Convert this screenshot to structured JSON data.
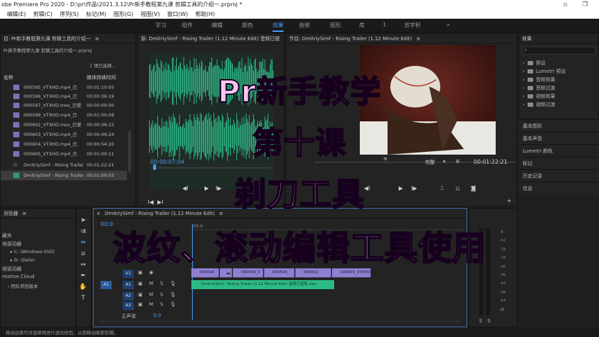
{
  "window": {
    "title": "obe Premiere Pro 2020 - D:\\pr\\作品\\2021.3.12\\Pr新手教程第九课 剪辑工具的介绍一.prproj *"
  },
  "menu": [
    "编辑(E)",
    "剪辑(C)",
    "序列(S)",
    "标记(M)",
    "图形(G)",
    "视图(V)",
    "窗口(W)",
    "帮助(H)"
  ],
  "workspaces": [
    "学习",
    "组件",
    "编辑",
    "颜色",
    "效果",
    "音频",
    "图形",
    "库",
    "1",
    "苏宇轩"
  ],
  "workspaces_more": "»",
  "active_workspace": "效果",
  "project": {
    "title": "目: Pr新手教程第九课 剪辑工具的介绍一",
    "path": "Pr新手教程第九课 剪辑工具的介绍一.prproj",
    "selection_info": "1 项已选择...",
    "col_name": "名称",
    "col_duration": "媒体持续时间",
    "rows": [
      {
        "name": "000595_VTXHD.mp4_已",
        "duration": "00:01:10:05",
        "kind": "video"
      },
      {
        "name": "000596_VTXHD.mp4_已",
        "duration": "00:00:36:19",
        "kind": "video"
      },
      {
        "name": "000597_VTXHD.mov_已使",
        "duration": "00:00:09:00",
        "kind": "video"
      },
      {
        "name": "000599_VTXHD.mp4_已",
        "duration": "00:01:00:09",
        "kind": "video"
      },
      {
        "name": "000602_VTXHD.mov_已使",
        "duration": "00:00:36:15",
        "kind": "video"
      },
      {
        "name": "000603_VTXHD.mp4_已",
        "duration": "00:00:46:24",
        "kind": "video"
      },
      {
        "name": "000604_VTXHD.mp4_已",
        "duration": "00:00:54:20",
        "kind": "video"
      },
      {
        "name": "000605_VTXHD.mp4_已",
        "duration": "00:01:00:11",
        "kind": "video"
      },
      {
        "name": "DmitriySimf - Rising Trailer",
        "duration": "00:01:22:21",
        "kind": "audio"
      },
      {
        "name": "DmitriySimf - Rising Trailer",
        "duration": "00:01:09:03",
        "kind": "sequence"
      }
    ]
  },
  "source": {
    "title": "源: DmitriySimf - Rising Trailer (1.12 Minute Edit) 音频已提",
    "timecode": "00:00:07:04"
  },
  "program": {
    "title": "节目: DmitriySimf - Rising Trailer (1.12 Minute Edit)",
    "quality": "完整",
    "timecode": "00:01:22:21"
  },
  "effects": {
    "title": "效果",
    "items": [
      "预设",
      "Lumetri 预设",
      "音频效果",
      "音频过渡",
      "视频效果",
      "视频过渡"
    ],
    "side_panels": [
      "基本图形",
      "基本声音",
      "Lumetri 颜色",
      "标记",
      "历史记录",
      "信息"
    ]
  },
  "media_browser": {
    "title": "浏览器",
    "items": [
      "藏夹",
      "地驱动器",
      "C: (Windows-SSD)",
      "D: (Data)",
      "络驱动器",
      "reative Cloud",
      "团队项目版本"
    ]
  },
  "timeline": {
    "title": "DmitriySimf - Rising Trailer (1.12 Minute Edit)",
    "timecode": "00:0",
    "ruler_mark": ";00:0",
    "tracks_v": [
      "V1"
    ],
    "tracks_a": [
      "A1",
      "A2",
      "A3"
    ],
    "src_patch": "A1",
    "master": "主声道",
    "master_val": "0.0",
    "video_clips": [
      "000594",
      "",
      "000596_V",
      "000599_",
      "000602",
      "000605_VTXHD."
    ],
    "audio_clip": "DmitriySimf - Rising Trailer (1.12 Minute Edit) 音频已提取.wav",
    "meter_labels": [
      "S",
      "S"
    ],
    "meter_db": [
      "-6",
      "-12",
      "-18",
      "-24",
      "-30",
      "-36",
      "-42",
      "-48",
      "-54",
      "dB"
    ]
  },
  "overlay": {
    "line1": "Pr新手教学",
    "line2": "第十课",
    "line3": "剃刀工具",
    "line4": "波纹、滚动编辑工具使用"
  },
  "status": "拖动边缘可对选择项进行波纹修剪。从而移动尾部剪辑。",
  "icons": {
    "close": "close-icon",
    "maximize": "maximize-icon",
    "menu": "hamburger-icon",
    "folder": "folder-icon",
    "play": "play-icon",
    "step_back": "step-back-icon",
    "step_fwd": "step-forward-icon",
    "wrench": "wrench-icon",
    "search": "search-icon"
  },
  "colors": {
    "accent": "#4a9eff",
    "video_clip": "#8e7fd0",
    "audio_clip": "#2cba87",
    "waveform": "#2cba87",
    "overlay_text": "#f8c4f2"
  }
}
